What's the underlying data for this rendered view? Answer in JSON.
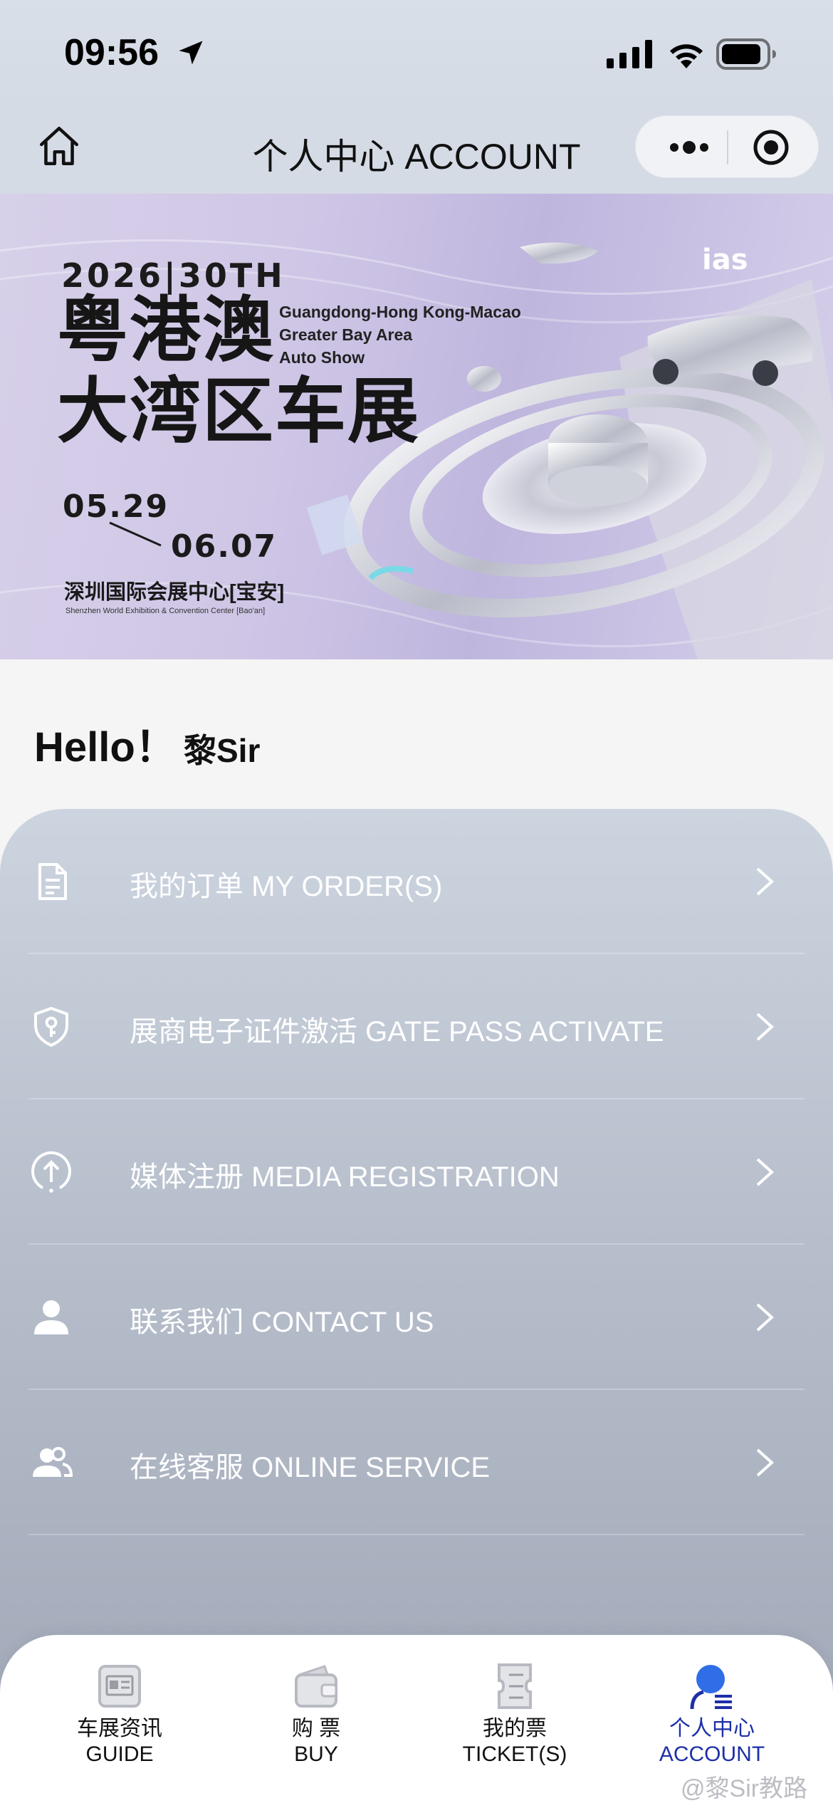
{
  "status_bar": {
    "time": "09:56"
  },
  "nav": {
    "title": "个人中心 ACCOUNT"
  },
  "banner": {
    "year_line": "2026|30TH",
    "cn_line1": "粤港澳",
    "cn_line2": "大湾区车展",
    "en_line1": "Guangdong-Hong Kong-Macao",
    "en_line2": "Greater Bay Area",
    "en_line3": "Auto Show",
    "date_start": "05.29",
    "date_end": "06.07",
    "venue_cn": "深圳国际会展中心[宝安]",
    "venue_en": "Shenzhen World Exhibition & Convention Center [Bao'an]",
    "logo_text": "ias"
  },
  "greeting": {
    "hello": "Hello！",
    "name": "黎Sir"
  },
  "menu": {
    "items": [
      {
        "label": "我的订单 MY ORDER(S)",
        "icon": "document-icon"
      },
      {
        "label": "展商电子证件激活 GATE PASS ACTIVATE",
        "icon": "shield-key-icon"
      },
      {
        "label": "媒体注册 MEDIA REGISTRATION",
        "icon": "upload-circle-icon"
      },
      {
        "label": "联系我们 CONTACT US",
        "icon": "person-icon"
      },
      {
        "label": "在线客服 ONLINE SERVICE",
        "icon": "people-icon"
      }
    ]
  },
  "tabs": [
    {
      "cn": "车展资讯",
      "en": "GUIDE",
      "icon": "newspaper-icon",
      "active": false
    },
    {
      "cn": "购 票",
      "en": "BUY",
      "icon": "wallet-icon",
      "active": false
    },
    {
      "cn": "我的票",
      "en": "TICKET(S)",
      "icon": "ticket-icon",
      "active": false
    },
    {
      "cn": "个人中心",
      "en": "ACCOUNT",
      "icon": "account-icon",
      "active": true
    }
  ],
  "watermark": "@黎Sir教路",
  "colors": {
    "accent": "#1e2fa8",
    "nav_bg": "#d5dbe5",
    "panel_top": "#ccd4df",
    "panel_bottom": "#a2a9b8"
  }
}
